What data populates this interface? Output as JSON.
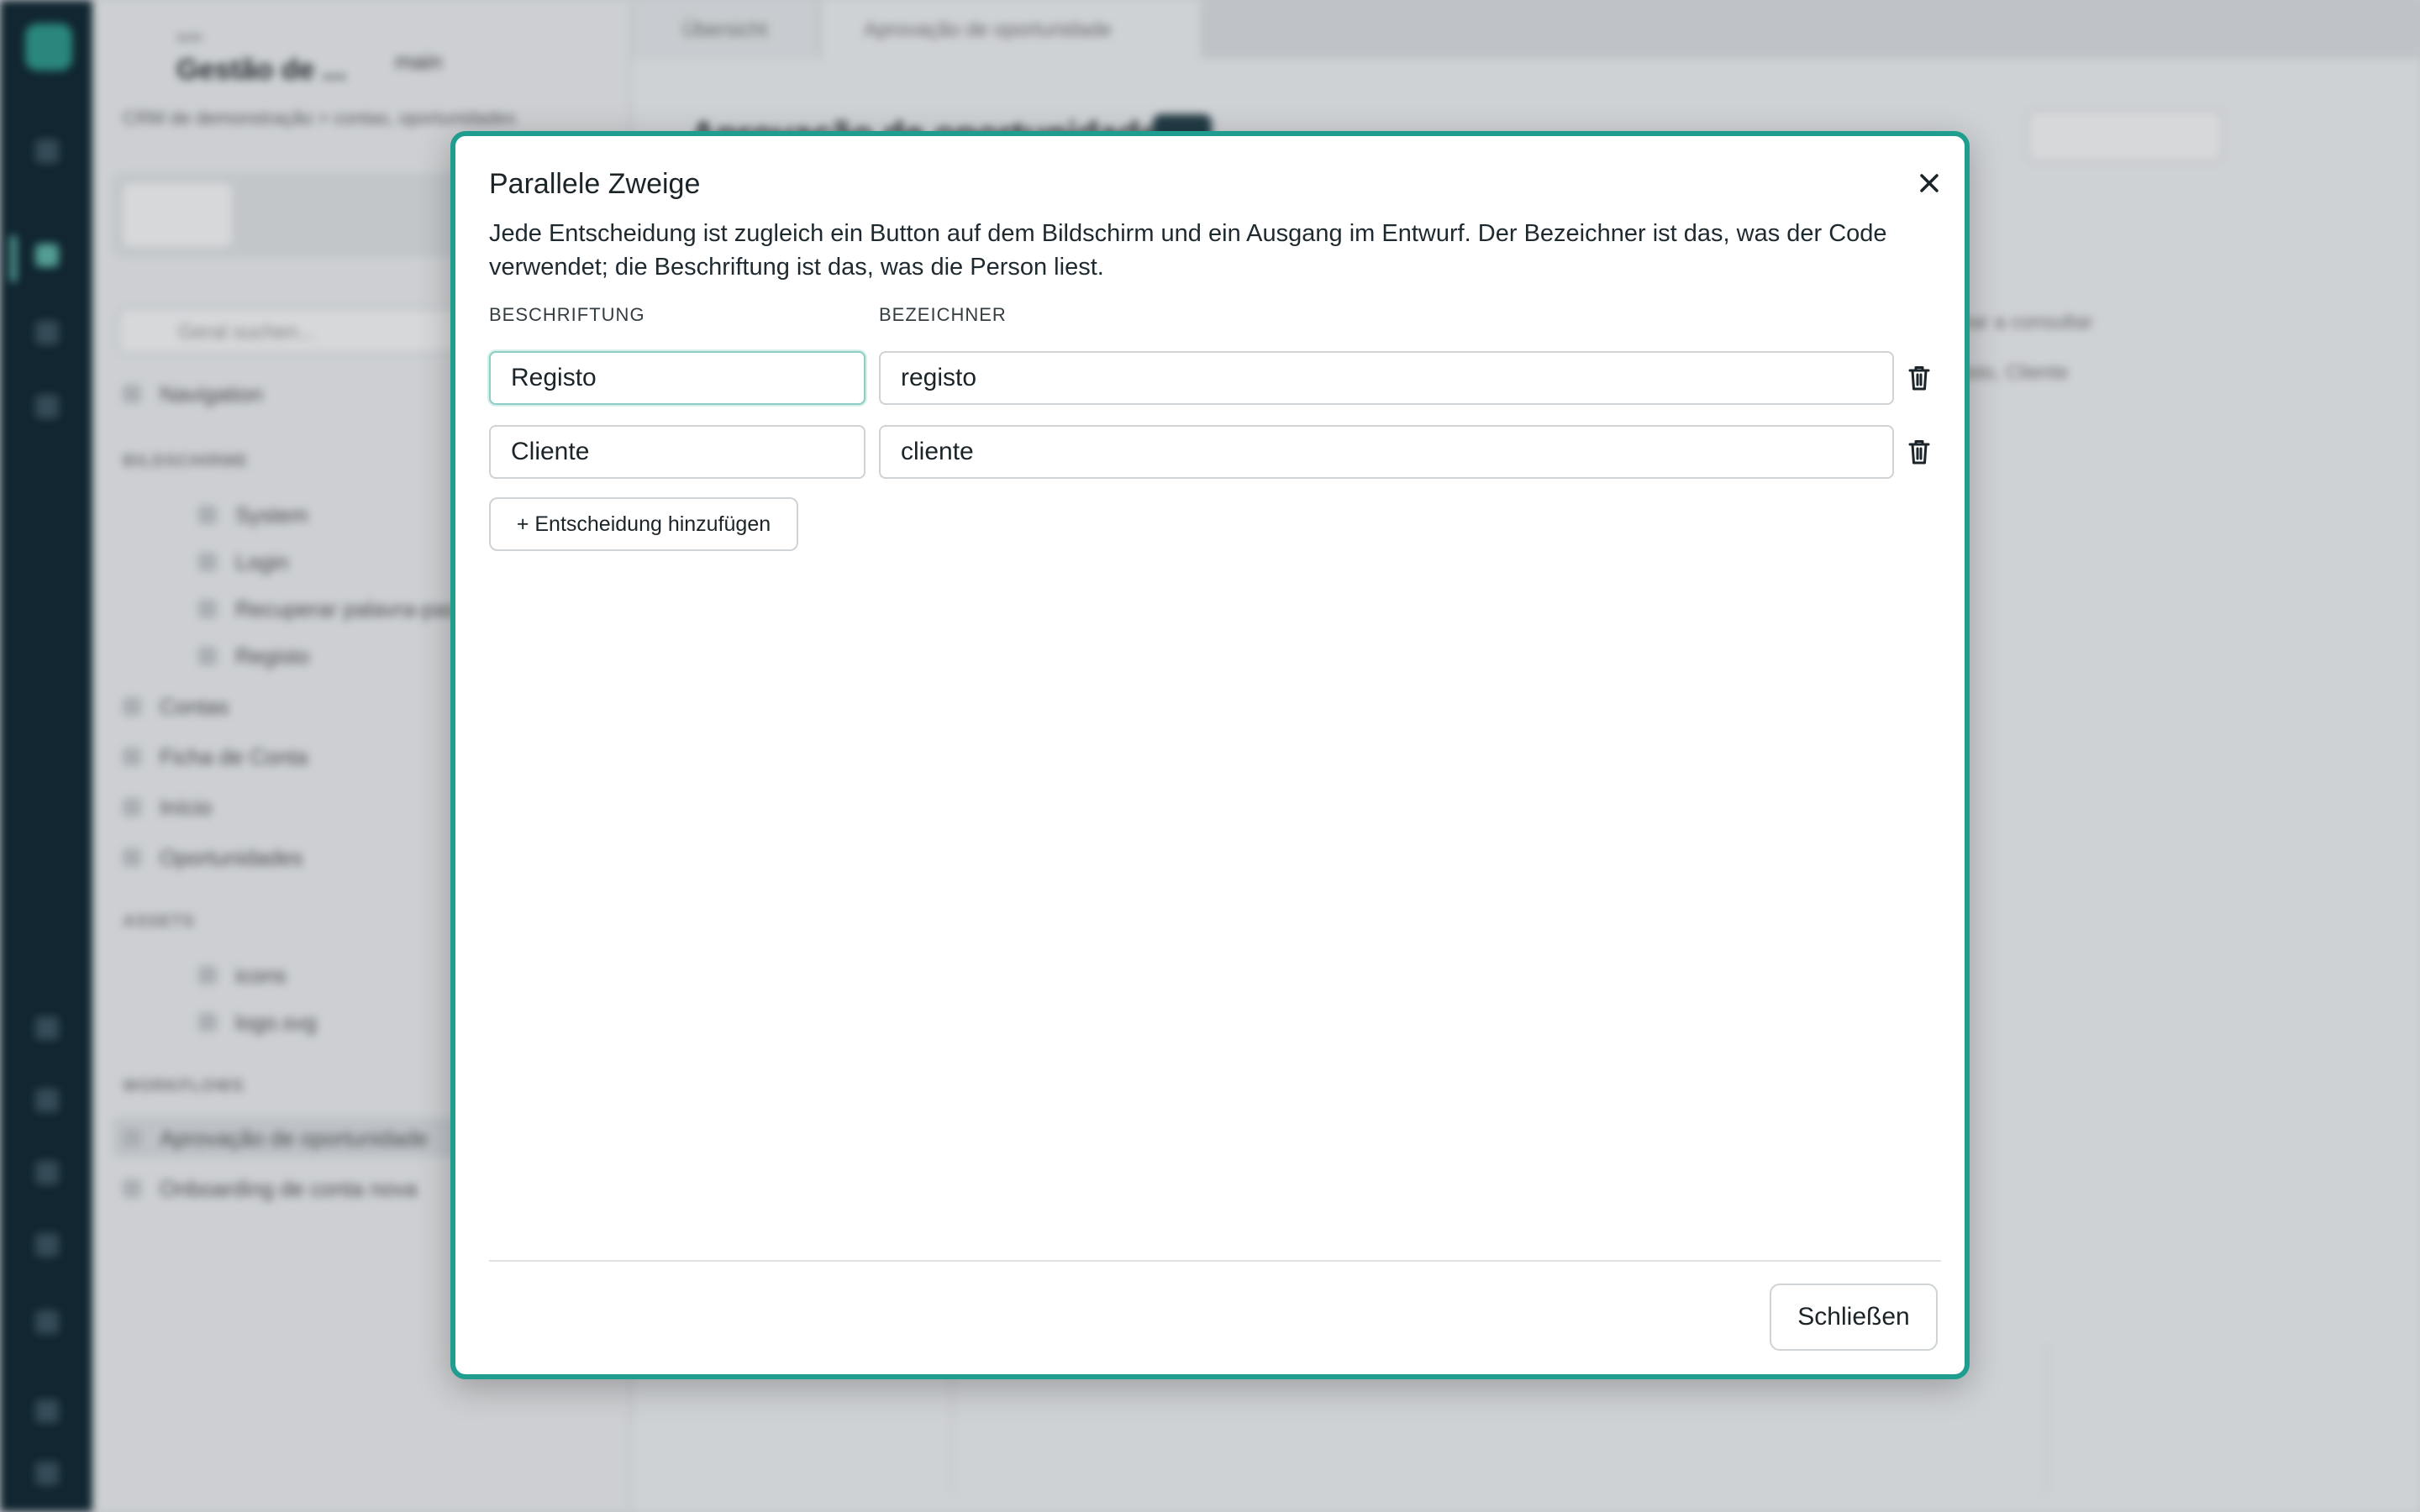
{
  "background": {
    "sidebar": {
      "project_label": "auto",
      "project_title": "Gestão de ...",
      "branch": "main",
      "breadcrumb": "CRM de demonstração > contas, oportunidades",
      "search_placeholder": "Geral suchen...",
      "nav": "Navigation",
      "section_screens": "BILDSCHIRME",
      "screens": [
        "System",
        "Login",
        "Recuperar palavra-passe",
        "Registo",
        "Contas",
        "Ficha de Conta",
        "Início",
        "Oportunidades"
      ],
      "section_assets": "ASSETS",
      "assets": [
        "icons",
        "logo.svg"
      ],
      "section_workflows": "WORKFLOWS",
      "workflows": [
        "Aprovação de oportunidade",
        "Onboarding de conta nova"
      ]
    },
    "tabs": [
      "Übersicht",
      "Aprovação de oportunidade"
    ],
    "page_title": "Aprovação de oportunidade",
    "panel_rows": [
      "Fechar a consultar",
      "Registo, Cliente"
    ]
  },
  "modal": {
    "title": "Parallele Zweige",
    "description": "Jede Entscheidung ist zugleich ein Button auf dem Bildschirm und ein Ausgang im Entwurf. Der Bezeichner ist das, was der Code verwendet; die Beschriftung ist das, was die Person liest.",
    "col_label": "BESCHRIFTUNG",
    "col_id": "BEZEICHNER",
    "rows": [
      {
        "label": "Registo",
        "id": "registo"
      },
      {
        "label": "Cliente",
        "id": "cliente"
      }
    ],
    "add_button": "+ Entscheidung hinzufügen",
    "close_button": "Schließen",
    "accent": "#1f9d8f"
  }
}
